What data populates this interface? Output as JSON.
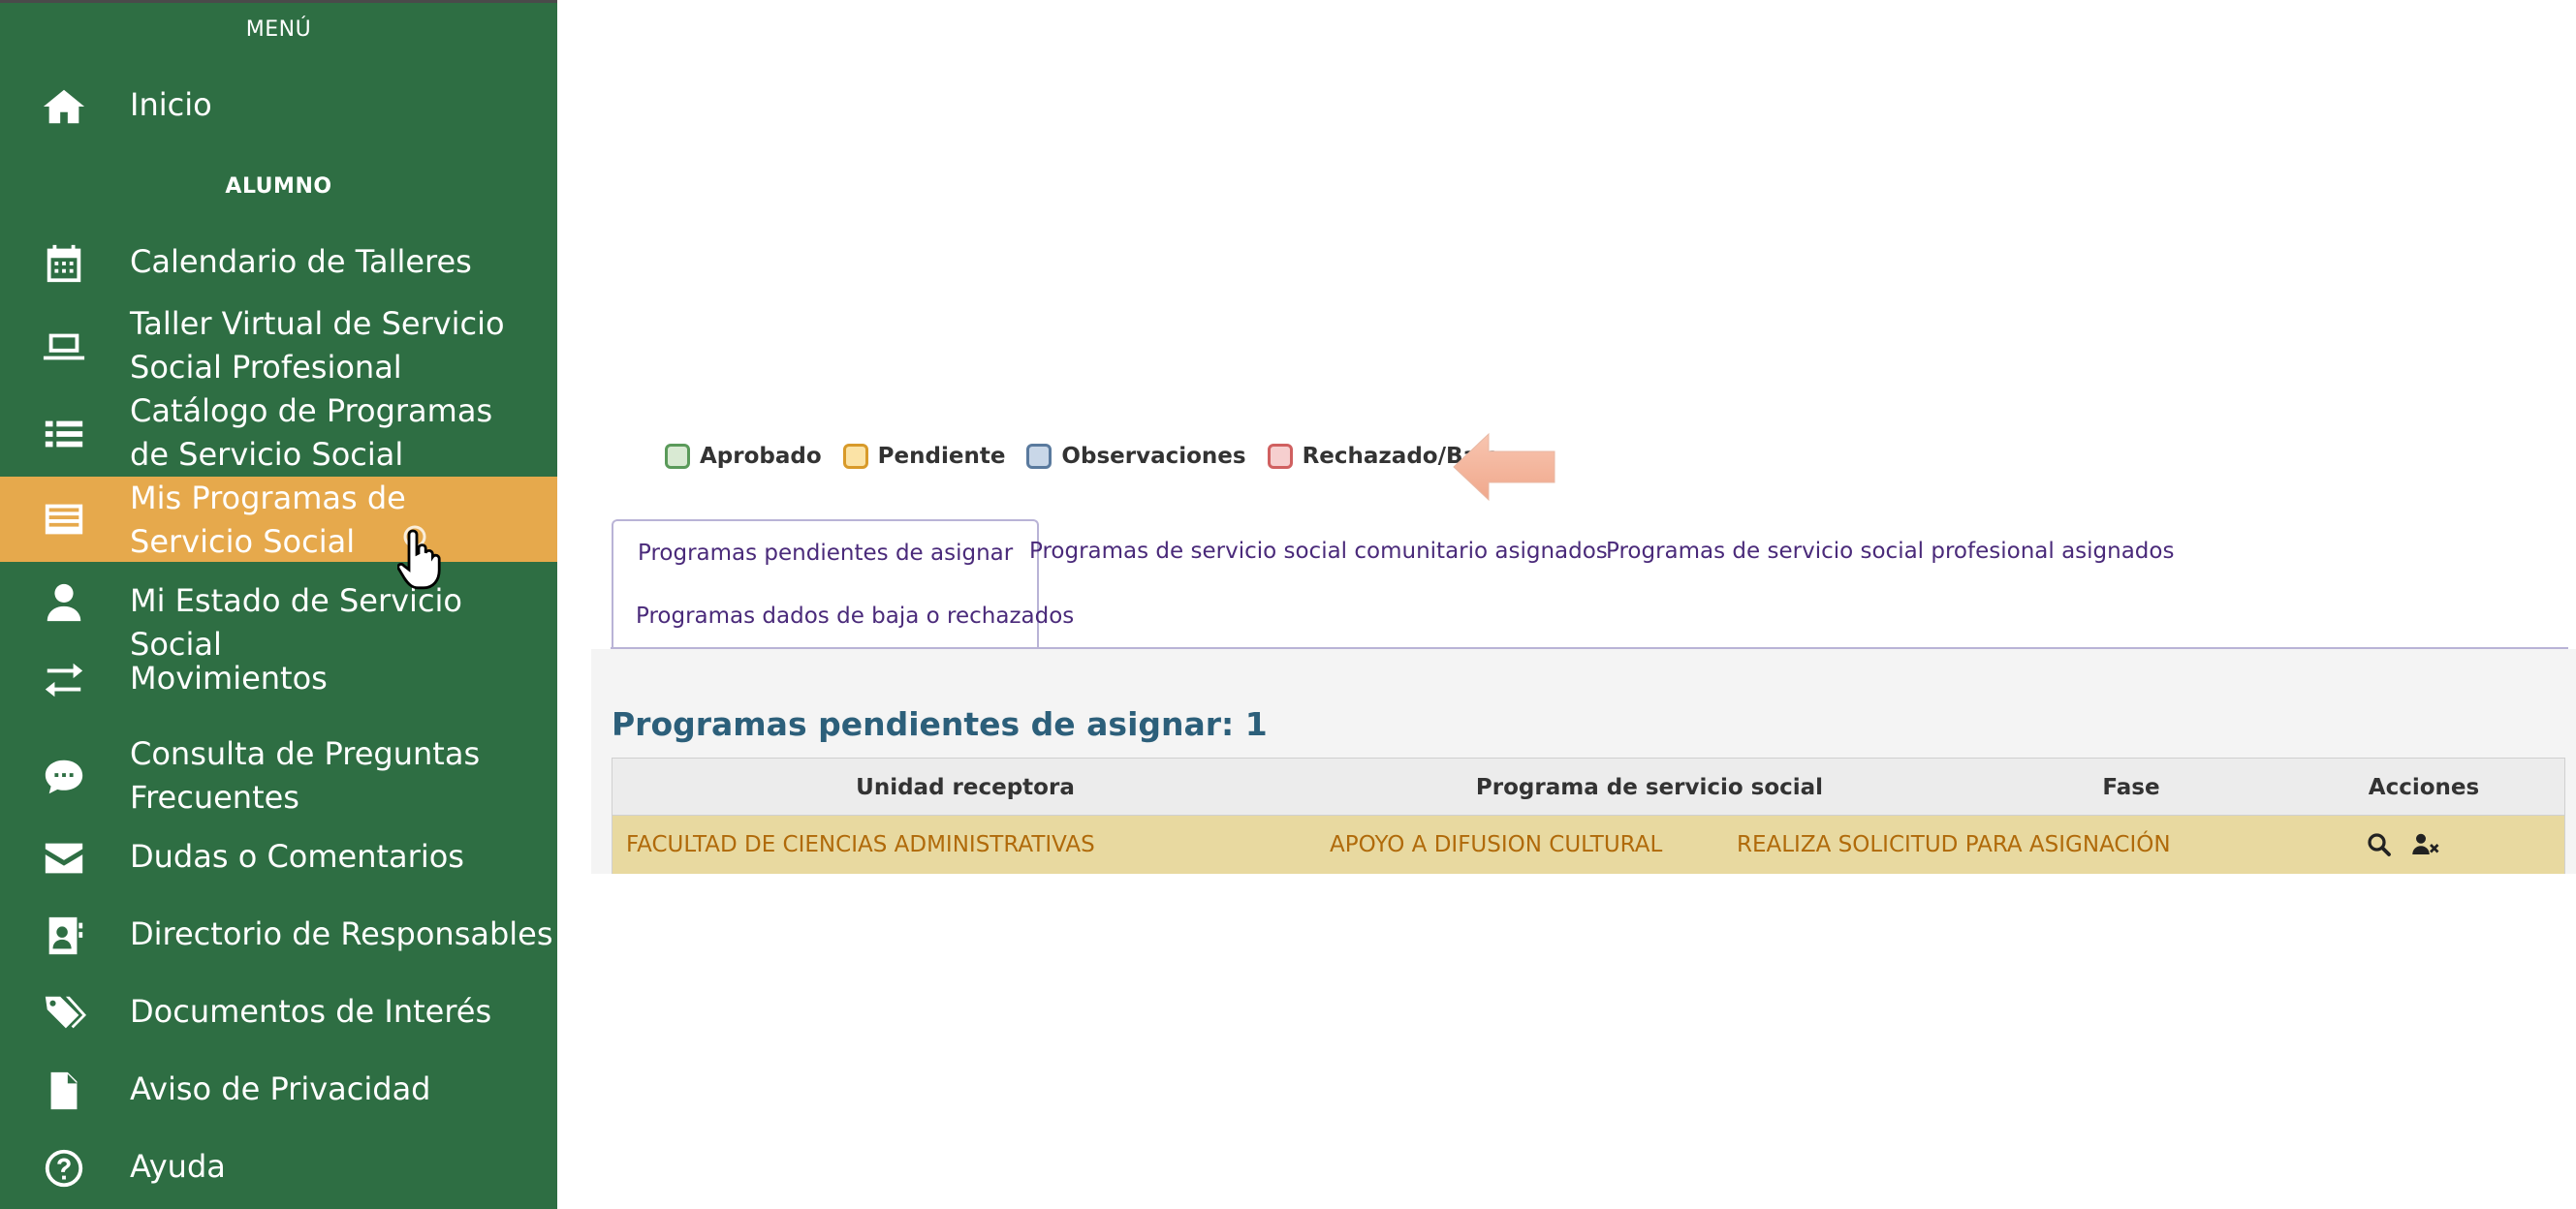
{
  "sidebar": {
    "menu_label": "MENÚ",
    "alumno_label": "ALUMNO",
    "items": [
      {
        "label": "Inicio",
        "icon": "home-icon"
      },
      {
        "label": "Calendario de Talleres",
        "icon": "calendar-icon"
      },
      {
        "label": "Taller Virtual de Servicio Social Profesional",
        "icon": "laptop-icon"
      },
      {
        "label": "Catálogo de Programas de Servicio Social",
        "icon": "list-icon"
      },
      {
        "label": "Mis Programas de Servicio Social",
        "icon": "card-list-icon",
        "active": true
      },
      {
        "label": "Mi Estado de Servicio Social",
        "icon": "user-icon"
      },
      {
        "label": "Movimientos",
        "icon": "exchange-icon"
      },
      {
        "label": "Consulta de Preguntas Frecuentes",
        "icon": "chat-icon"
      },
      {
        "label": "Dudas o Comentarios",
        "icon": "envelope-icon"
      },
      {
        "label": "Directorio de Responsables",
        "icon": "address-book-icon"
      },
      {
        "label": "Documentos de Interés",
        "icon": "tags-icon"
      },
      {
        "label": "Aviso de Privacidad",
        "icon": "file-icon"
      },
      {
        "label": "Ayuda",
        "icon": "question-icon"
      }
    ]
  },
  "legend": [
    {
      "label": "Aprobado",
      "fill": "#d9ead3",
      "border": "#5a9a5a"
    },
    {
      "label": "Pendiente",
      "fill": "#fbe3a6",
      "border": "#d89a2a"
    },
    {
      "label": "Observaciones",
      "fill": "#c9d7e8",
      "border": "#5a7a9e"
    },
    {
      "label": "Rechazado/Baja",
      "fill": "#f6cfcf",
      "border": "#d06060"
    }
  ],
  "tabs": [
    {
      "label": "Programas pendientes de asignar",
      "active": true
    },
    {
      "label": "Programas de servicio social comunitario asignados"
    },
    {
      "label": "Programas de servicio social profesional asignados"
    },
    {
      "label": "Programas dados de baja o rechazados"
    }
  ],
  "panel": {
    "title": "Programas pendientes de asignar: 1",
    "columns": [
      "Unidad receptora",
      "Programa de servicio social",
      "Fase",
      "Acciones"
    ],
    "rows": [
      {
        "unidad": "FACULTAD DE CIENCIAS ADMINISTRATIVAS",
        "programa": "APOYO A DIFUSION CULTURAL",
        "fase": "REALIZA SOLICITUD PARA ASIGNACIÓN",
        "actions": [
          "search-icon",
          "remove-user-icon"
        ]
      }
    ]
  },
  "colors": {
    "sidebar_bg": "#2e6e43",
    "active_item": "#e6a94c",
    "row_pending": "#e8d9a0",
    "title": "#2c5f7a",
    "tab_text": "#4a2a7a"
  }
}
